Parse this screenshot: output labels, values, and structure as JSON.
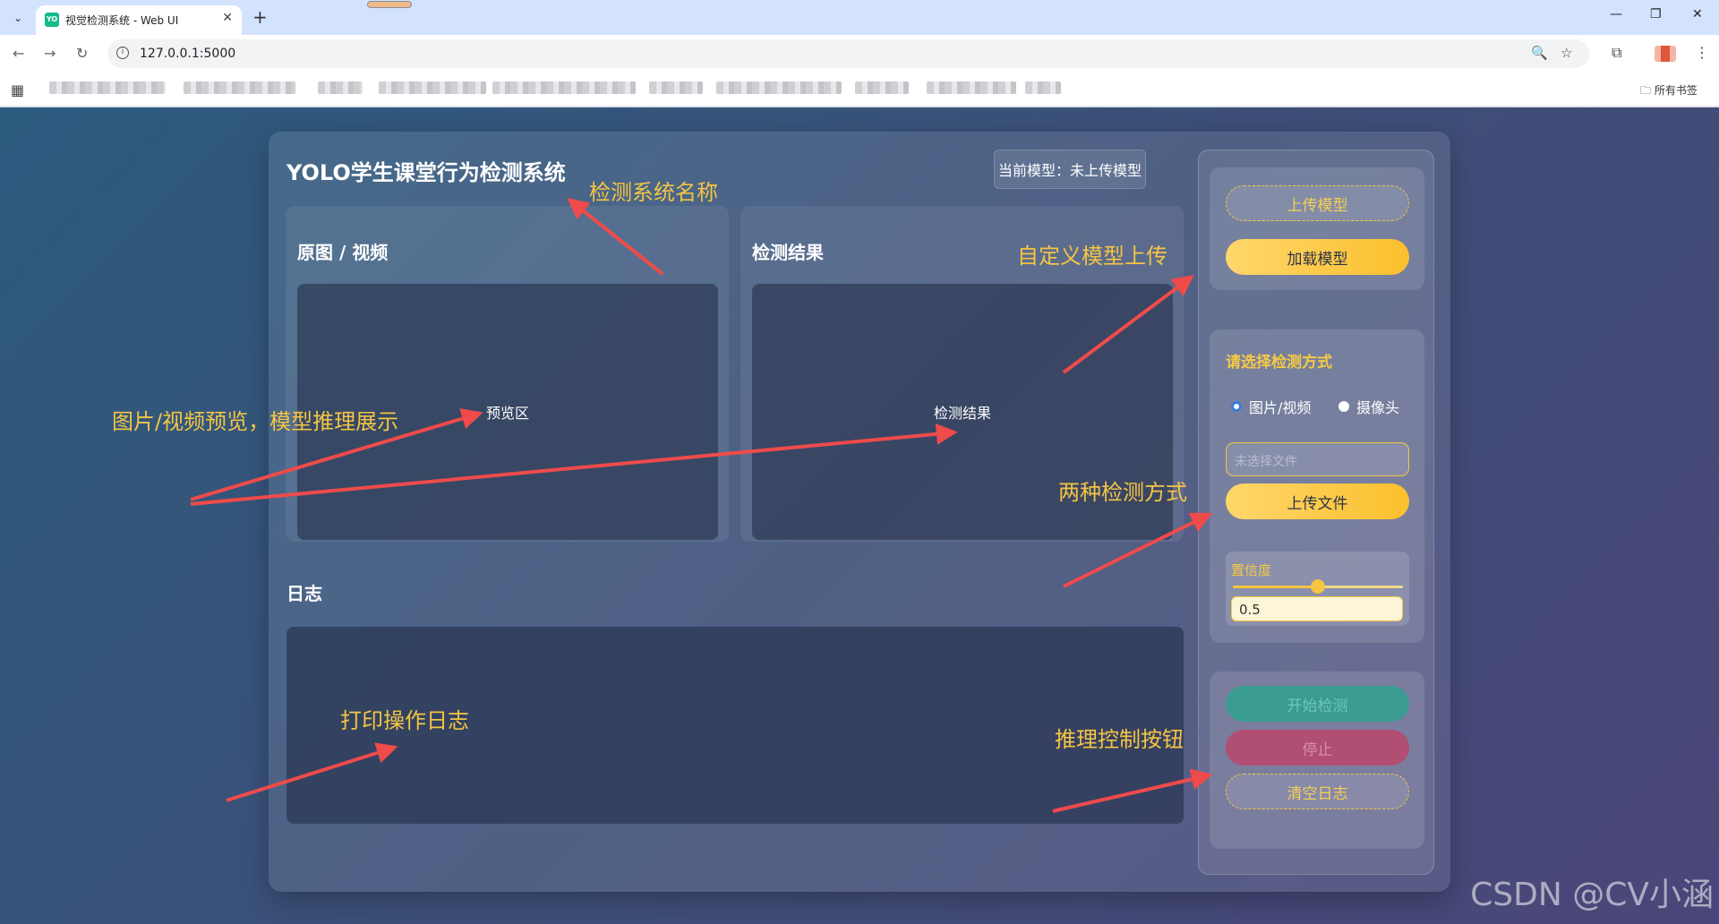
{
  "browser": {
    "tab_title": "视觉检测系统 - Web UI",
    "tab_favicon_text": "YO",
    "url": "127.0.0.1:5000",
    "bookmarks_all_label": "所有书签"
  },
  "app": {
    "title": "YOLO学生课堂行为检测系统",
    "current_model": "当前模型：未上传模型",
    "source_card": {
      "title": "原图 / 视频",
      "placeholder": "预览区"
    },
    "result_card": {
      "title": "检测结果",
      "placeholder": "检测结果"
    },
    "log_title": "日志"
  },
  "sidebar": {
    "upload_model_label": "上传模型",
    "load_model_label": "加载模型",
    "mode_title": "请选择检测方式",
    "mode_options": [
      "图片/视频",
      "摄像头"
    ],
    "selected_mode": "图片/视频",
    "file_placeholder": "未选择文件",
    "upload_file_label": "上传文件",
    "confidence_label": "置信度",
    "confidence_value": "0.5",
    "start_label": "开始检测",
    "stop_label": "停止",
    "clear_log_label": "清空日志"
  },
  "annotations": {
    "system_name": "检测系统名称",
    "custom_model": "自定义模型上传",
    "preview": "图片/视频预览，模型推理展示",
    "two_modes": "两种检测方式",
    "log": "打印操作日志",
    "control": "推理控制按钮"
  },
  "watermark": "CSDN @CV小涵",
  "colors": {
    "accent": "#f4c542",
    "arrow": "#ef4b4b",
    "start_button": "#3a9b91",
    "stop_button": "#b04e73"
  }
}
